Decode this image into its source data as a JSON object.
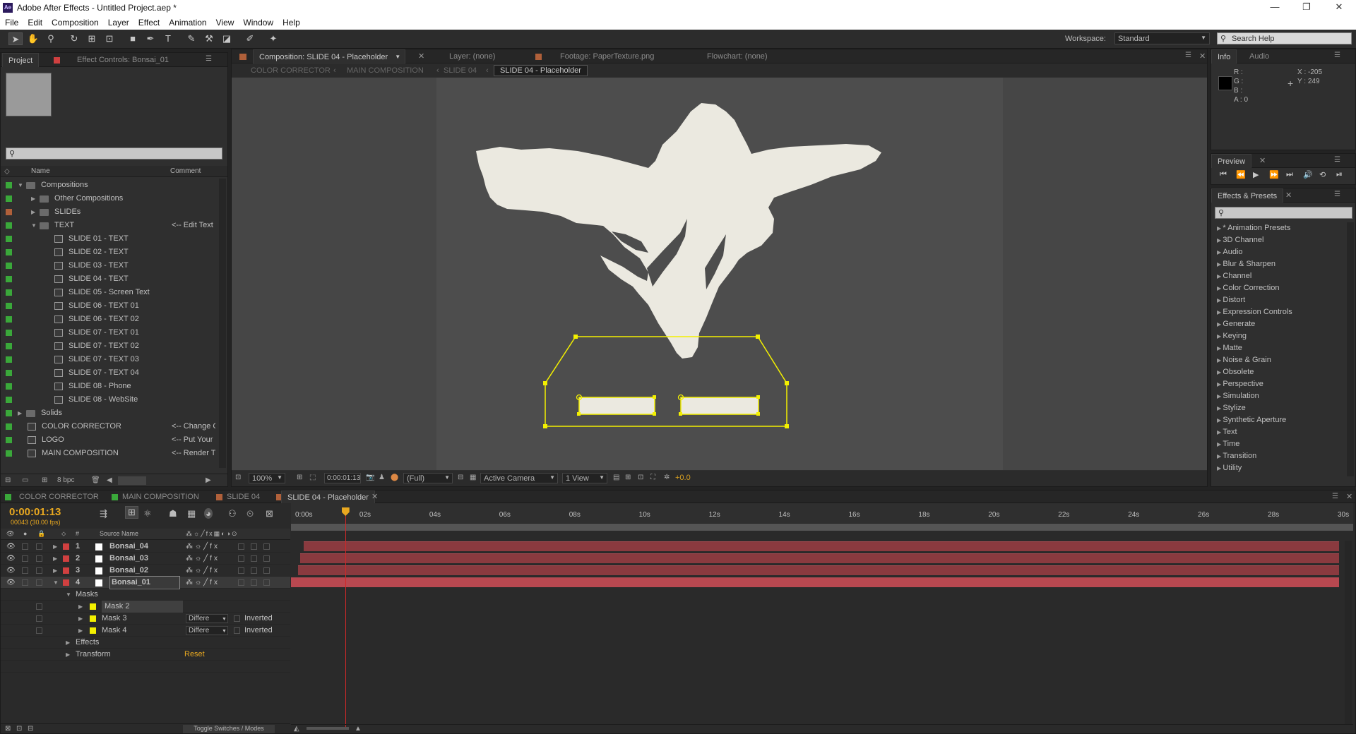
{
  "app": {
    "title": "Adobe After Effects - Untitled Project.aep *",
    "logo": "Ae"
  },
  "window_controls": {
    "minimize": "—",
    "maximize": "❐",
    "close": "✕"
  },
  "menu": [
    "File",
    "Edit",
    "Composition",
    "Layer",
    "Effect",
    "Animation",
    "View",
    "Window",
    "Help"
  ],
  "toolbar": {
    "workspace_label": "Workspace:",
    "workspace_value": "Standard",
    "search_placeholder": "Search Help"
  },
  "project_panel": {
    "tab_project": "Project",
    "tab_effect_controls": "Effect Controls: Bonsai_01",
    "col_name": "Name",
    "col_comment": "Comment",
    "bpc": "8 bpc",
    "items": [
      {
        "name": "Compositions",
        "type": "folder",
        "indent": 0,
        "open": true,
        "comment": "",
        "color": "#3aa83a"
      },
      {
        "name": "Other Compositions",
        "type": "folder",
        "indent": 1,
        "open": false,
        "comment": "",
        "color": "#3aa83a"
      },
      {
        "name": "SLIDEs",
        "type": "folder",
        "indent": 1,
        "open": false,
        "comment": "",
        "color": "#b0603a"
      },
      {
        "name": "TEXT",
        "type": "folder",
        "indent": 1,
        "open": true,
        "comment": "<-- Edit Text",
        "color": "#3aa83a"
      },
      {
        "name": "SLIDE 01 - TEXT",
        "type": "comp",
        "indent": 2,
        "comment": "",
        "color": "#3aa83a"
      },
      {
        "name": "SLIDE 02 - TEXT",
        "type": "comp",
        "indent": 2,
        "comment": "",
        "color": "#3aa83a"
      },
      {
        "name": "SLIDE 03 - TEXT",
        "type": "comp",
        "indent": 2,
        "comment": "",
        "color": "#3aa83a"
      },
      {
        "name": "SLIDE 04 - TEXT",
        "type": "comp",
        "indent": 2,
        "comment": "",
        "color": "#3aa83a"
      },
      {
        "name": "SLIDE 05 - Screen Text",
        "type": "comp",
        "indent": 2,
        "comment": "",
        "color": "#3aa83a"
      },
      {
        "name": "SLIDE 06 - TEXT 01",
        "type": "comp",
        "indent": 2,
        "comment": "",
        "color": "#3aa83a"
      },
      {
        "name": "SLIDE 06 - TEXT 02",
        "type": "comp",
        "indent": 2,
        "comment": "",
        "color": "#3aa83a"
      },
      {
        "name": "SLIDE 07 - TEXT 01",
        "type": "comp",
        "indent": 2,
        "comment": "",
        "color": "#3aa83a"
      },
      {
        "name": "SLIDE 07 - TEXT 02",
        "type": "comp",
        "indent": 2,
        "comment": "",
        "color": "#3aa83a"
      },
      {
        "name": "SLIDE 07 - TEXT 03",
        "type": "comp",
        "indent": 2,
        "comment": "",
        "color": "#3aa83a"
      },
      {
        "name": "SLIDE 07 - TEXT 04",
        "type": "comp",
        "indent": 2,
        "comment": "",
        "color": "#3aa83a"
      },
      {
        "name": "SLIDE 08 - Phone",
        "type": "comp",
        "indent": 2,
        "comment": "",
        "color": "#3aa83a"
      },
      {
        "name": "SLIDE 08 - WebSite",
        "type": "comp",
        "indent": 2,
        "comment": "",
        "color": "#3aa83a"
      },
      {
        "name": "Solids",
        "type": "folder",
        "indent": 0,
        "open": false,
        "comment": "",
        "color": "#3aa83a"
      },
      {
        "name": "COLOR CORRECTOR",
        "type": "comp",
        "indent": 0,
        "comment": "<-- Change C",
        "color": "#3aa83a"
      },
      {
        "name": "LOGO",
        "type": "comp",
        "indent": 0,
        "comment": "<-- Put Your",
        "color": "#3aa83a"
      },
      {
        "name": "MAIN COMPOSITION",
        "type": "comp",
        "indent": 0,
        "comment": "<-- Render T",
        "color": "#3aa83a"
      }
    ]
  },
  "comp_panel": {
    "tab_comp": "Composition: SLIDE 04 - Placeholder",
    "tab_layer": "Layer: (none)",
    "tab_footage": "Footage: PaperTexture.png",
    "tab_flowchart": "Flowchart: (none)",
    "breadcrumbs": [
      "COLOR CORRECTOR",
      "MAIN COMPOSITION",
      "SLIDE 04",
      "SLIDE 04 - Placeholder"
    ],
    "zoom": "100%",
    "timecode": "0:00:01:13",
    "resolution": "(Full)",
    "camera": "Active Camera",
    "views": "1 View",
    "exposure": "+0.0"
  },
  "info_panel": {
    "tab_info": "Info",
    "tab_audio": "Audio",
    "r": "R :",
    "g": "G :",
    "b": "B :",
    "a": "A : 0",
    "x": "X : -205",
    "y": "Y : 249"
  },
  "preview_panel": {
    "tab": "Preview"
  },
  "effects_panel": {
    "tab": "Effects & Presets",
    "items": [
      "* Animation Presets",
      "3D Channel",
      "Audio",
      "Blur & Sharpen",
      "Channel",
      "Color Correction",
      "Distort",
      "Expression Controls",
      "Generate",
      "Keying",
      "Matte",
      "Noise & Grain",
      "Obsolete",
      "Perspective",
      "Simulation",
      "Stylize",
      "Synthetic Aperture",
      "Text",
      "Time",
      "Transition",
      "Utility"
    ]
  },
  "timeline": {
    "tabs": [
      "COLOR CORRECTOR",
      "MAIN COMPOSITION",
      "SLIDE 04",
      "SLIDE 04 - Placeholder"
    ],
    "timecode": "0:00:01:13",
    "frames": "00043 (30.00 fps)",
    "col_source": "Source Name",
    "ruler": [
      "0:00s",
      "02s",
      "04s",
      "06s",
      "08s",
      "10s",
      "12s",
      "14s",
      "16s",
      "18s",
      "20s",
      "22s",
      "24s",
      "26s",
      "28s",
      "30s"
    ],
    "layers": [
      {
        "num": "1",
        "name": "Bonsai_04",
        "start": 0.012
      },
      {
        "num": "2",
        "name": "Bonsai_03",
        "start": 0.009
      },
      {
        "num": "3",
        "name": "Bonsai_02",
        "start": 0.007
      },
      {
        "num": "4",
        "name": "Bonsai_01",
        "start": 0.0,
        "selected": true
      }
    ],
    "sub": {
      "masks": "Masks",
      "mask2": "Mask 2",
      "mask3": "Mask 3",
      "mask4": "Mask 4",
      "mode": "Differe",
      "inverted": "Inverted",
      "effects": "Effects",
      "transform": "Transform",
      "reset": "Reset"
    },
    "toggle": "Toggle Switches / Modes",
    "playhead_seconds": 1.43
  }
}
